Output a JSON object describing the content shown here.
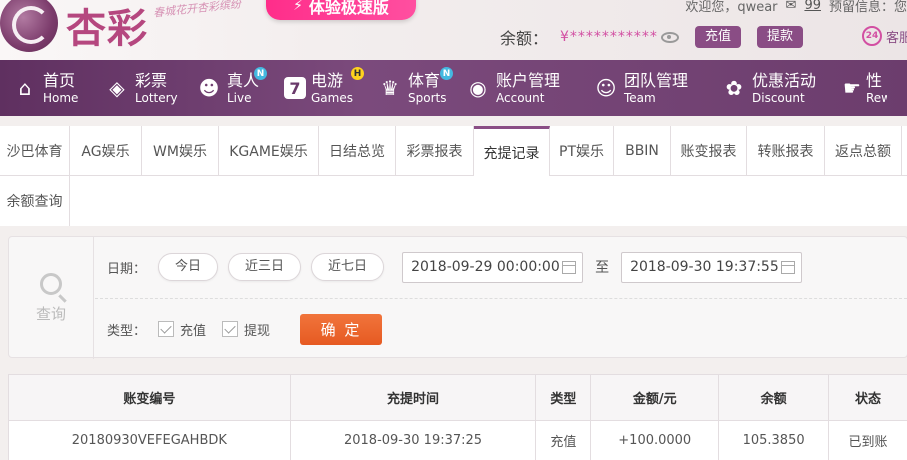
{
  "header": {
    "logo_text": "杏彩",
    "slogan": "春城花开杏彩缤纷",
    "promo_label": "体验极速版",
    "welcome": "欢迎您，",
    "username": "qwear",
    "mail_count": "99",
    "notice_label": "预留信息：您",
    "balance_label": "余额：",
    "balance_masked": "¥***********",
    "recharge_label": "充值",
    "withdraw_label": "提款",
    "service_badge": "24",
    "service_label": "客服"
  },
  "nav": [
    {
      "cn": "首页",
      "en": "Home",
      "icon": "home-icon"
    },
    {
      "cn": "彩票",
      "en": "Lottery",
      "icon": "ticket-icon"
    },
    {
      "cn": "真人",
      "en": "Live",
      "icon": "person-icon",
      "badge": "N"
    },
    {
      "cn": "电游",
      "en": "Games",
      "icon": "seven-icon",
      "badge": "H"
    },
    {
      "cn": "体育",
      "en": "Sports",
      "icon": "trophy-icon",
      "badge": "N"
    },
    {
      "cn": "账户管理",
      "en": "Account",
      "icon": "account-icon"
    },
    {
      "cn": "团队管理",
      "en": "Team",
      "icon": "team-icon"
    },
    {
      "cn": "优惠活动",
      "en": "Discount",
      "icon": "gift-icon"
    },
    {
      "cn": "性",
      "en": "Rew",
      "icon": "hand-icon"
    }
  ],
  "tabs_row1": [
    "沙巴体育",
    "AG娱乐",
    "WM娱乐",
    "KGAME娱乐",
    "日结总览",
    "彩票报表",
    "充提记录",
    "PT娱乐",
    "BBIN",
    "账变报表",
    "转账报表",
    "返点总额"
  ],
  "active_tab": "充提记录",
  "tabs_row2": [
    "余额查询"
  ],
  "filter": {
    "query_label": "查询",
    "date_label": "日期：",
    "quick_ranges": [
      "今日",
      "近三日",
      "近七日"
    ],
    "date_start": "2018-09-29 00:00:00",
    "to_label": "至",
    "date_end": "2018-09-30 19:37:55",
    "type_label": "类型：",
    "type_options": [
      "充值",
      "提现"
    ],
    "confirm_label": "确 定"
  },
  "table": {
    "headers": [
      "账变编号",
      "充提时间",
      "类型",
      "金额/元",
      "余额",
      "状态"
    ],
    "rows": [
      [
        "20180930VEFEGAHBDK",
        "2018-09-30 19:37:25",
        "充值",
        "+100.0000",
        "105.3850",
        "已到账"
      ]
    ]
  },
  "colors": {
    "brand_purple": "#7b4a7c",
    "accent_pink": "#d24fa2",
    "confirm_orange": "#e65a22",
    "amount_red": "#e0352b",
    "status_green": "#2ca02c"
  }
}
